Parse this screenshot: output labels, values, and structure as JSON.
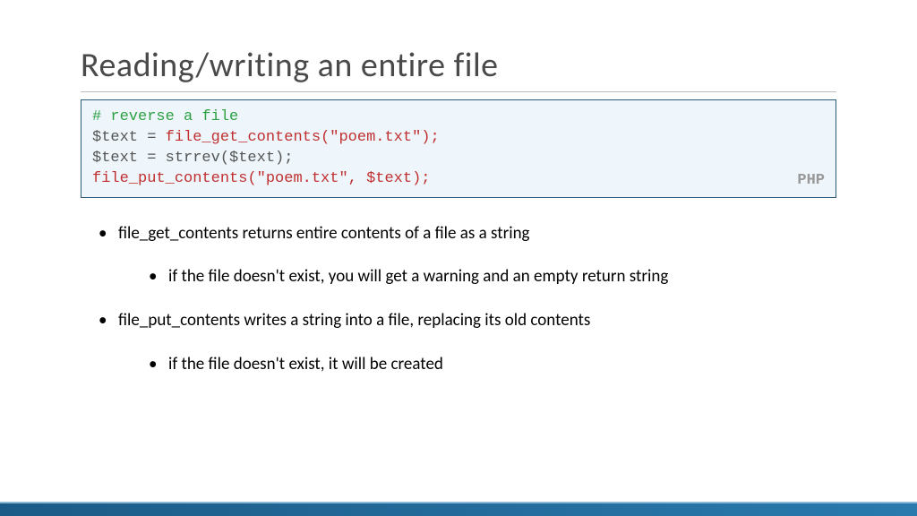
{
  "title": "Reading/writing an entire file",
  "code": {
    "lang_label": "PHP",
    "line1_comment": "# reverse a file",
    "line2_var": "$text = ",
    "line2_func": "file_get_contents",
    "line2_open": "(\"",
    "line2_str": "poem.txt",
    "line2_close": "\");",
    "line3": "$text = strrev($text);",
    "line4_func": "file_put_contents",
    "line4_open": "(\"",
    "line4_str": "poem.txt",
    "line4_mid": "\", $text);"
  },
  "bullets": [
    {
      "text": "file_get_contents returns entire contents of a file as a string",
      "sub": "if the file doesn't exist, you will get a warning and an empty return string"
    },
    {
      "text": "file_put_contents writes a string into a file, replacing its old contents",
      "sub": "if the file doesn't exist, it will be created"
    }
  ]
}
